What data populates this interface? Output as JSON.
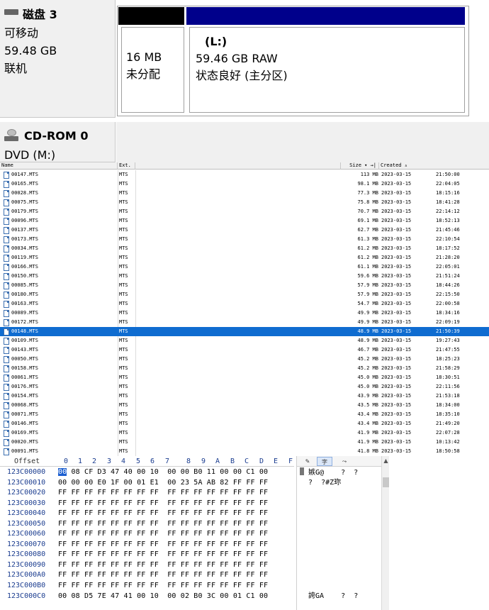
{
  "disk3": {
    "title": "磁盘 3",
    "type": "可移动",
    "size": "59.48 GB",
    "status": "联机",
    "partitions": [
      {
        "size": "16 MB",
        "state": "未分配"
      },
      {
        "volume": "(L:)",
        "size_fs": "59.46 GB RAW",
        "state": "状态良好 (主分区)"
      }
    ]
  },
  "cdrom": {
    "title": "CD-ROM 0",
    "drive": "DVD (M:)"
  },
  "file_list": {
    "columns": {
      "name": "Name",
      "ext": "Ext.",
      "size": "Size ▾ →|",
      "created": "Created ▵"
    },
    "selected_index": 17,
    "rows": [
      {
        "name": "00147.MTS",
        "ext": "MTS",
        "size": "113 MB",
        "date": "2023-03-15",
        "time": "21:50:00"
      },
      {
        "name": "00165.MTS",
        "ext": "MTS",
        "size": "98.1 MB",
        "date": "2023-03-15",
        "time": "22:04:05"
      },
      {
        "name": "00028.MTS",
        "ext": "MTS",
        "size": "77.3 MB",
        "date": "2023-03-15",
        "time": "18:15:16"
      },
      {
        "name": "00075.MTS",
        "ext": "MTS",
        "size": "75.8 MB",
        "date": "2023-03-15",
        "time": "18:41:28"
      },
      {
        "name": "00179.MTS",
        "ext": "MTS",
        "size": "70.7 MB",
        "date": "2023-03-15",
        "time": "22:14:12"
      },
      {
        "name": "00096.MTS",
        "ext": "MTS",
        "size": "69.1 MB",
        "date": "2023-03-15",
        "time": "18:52:13"
      },
      {
        "name": "00137.MTS",
        "ext": "MTS",
        "size": "62.7 MB",
        "date": "2023-03-15",
        "time": "21:45:46"
      },
      {
        "name": "00173.MTS",
        "ext": "MTS",
        "size": "61.3 MB",
        "date": "2023-03-15",
        "time": "22:10:54"
      },
      {
        "name": "00034.MTS",
        "ext": "MTS",
        "size": "61.2 MB",
        "date": "2023-03-15",
        "time": "18:17:52"
      },
      {
        "name": "00119.MTS",
        "ext": "MTS",
        "size": "61.2 MB",
        "date": "2023-03-15",
        "time": "21:28:20"
      },
      {
        "name": "00166.MTS",
        "ext": "MTS",
        "size": "61.1 MB",
        "date": "2023-03-15",
        "time": "22:05:01"
      },
      {
        "name": "00150.MTS",
        "ext": "MTS",
        "size": "59.6 MB",
        "date": "2023-03-15",
        "time": "21:51:24"
      },
      {
        "name": "00085.MTS",
        "ext": "MTS",
        "size": "57.9 MB",
        "date": "2023-03-15",
        "time": "18:44:26"
      },
      {
        "name": "00180.MTS",
        "ext": "MTS",
        "size": "57.9 MB",
        "date": "2023-03-15",
        "time": "22:15:50"
      },
      {
        "name": "00163.MTS",
        "ext": "MTS",
        "size": "54.7 MB",
        "date": "2023-03-15",
        "time": "22:00:58"
      },
      {
        "name": "00089.MTS",
        "ext": "MTS",
        "size": "49.9 MB",
        "date": "2023-03-15",
        "time": "18:34:16"
      },
      {
        "name": "00172.MTS",
        "ext": "MTS",
        "size": "49.9 MB",
        "date": "2023-03-15",
        "time": "22:09:19"
      },
      {
        "name": "00148.MTS",
        "ext": "MTS",
        "size": "48.9 MB",
        "date": "2023-03-15",
        "time": "21:50:39"
      },
      {
        "name": "00109.MTS",
        "ext": "MTS",
        "size": "48.9 MB",
        "date": "2023-03-15",
        "time": "19:27:43"
      },
      {
        "name": "00143.MTS",
        "ext": "MTS",
        "size": "46.7 MB",
        "date": "2023-03-15",
        "time": "21:47:55"
      },
      {
        "name": "00050.MTS",
        "ext": "MTS",
        "size": "45.2 MB",
        "date": "2023-03-15",
        "time": "18:25:23"
      },
      {
        "name": "00158.MTS",
        "ext": "MTS",
        "size": "45.2 MB",
        "date": "2023-03-15",
        "time": "21:58:29"
      },
      {
        "name": "00061.MTS",
        "ext": "MTS",
        "size": "45.0 MB",
        "date": "2023-03-15",
        "time": "18:30:51"
      },
      {
        "name": "00176.MTS",
        "ext": "MTS",
        "size": "45.0 MB",
        "date": "2023-03-15",
        "time": "22:11:56"
      },
      {
        "name": "00154.MTS",
        "ext": "MTS",
        "size": "43.9 MB",
        "date": "2023-03-15",
        "time": "21:53:18"
      },
      {
        "name": "00068.MTS",
        "ext": "MTS",
        "size": "43.5 MB",
        "date": "2023-03-15",
        "time": "18:34:00"
      },
      {
        "name": "00071.MTS",
        "ext": "MTS",
        "size": "43.4 MB",
        "date": "2023-03-15",
        "time": "18:35:10"
      },
      {
        "name": "00146.MTS",
        "ext": "MTS",
        "size": "43.4 MB",
        "date": "2023-03-15",
        "time": "21:49:20"
      },
      {
        "name": "00169.MTS",
        "ext": "MTS",
        "size": "41.9 MB",
        "date": "2023-03-15",
        "time": "22:07:28"
      },
      {
        "name": "00020.MTS",
        "ext": "MTS",
        "size": "41.9 MB",
        "date": "2023-03-15",
        "time": "10:13:42"
      },
      {
        "name": "00091.MTS",
        "ext": "MTS",
        "size": "41.8 MB",
        "date": "2023-03-15",
        "time": "18:50:58"
      }
    ]
  },
  "hex_view": {
    "offset_label": "Offset",
    "column_headers": [
      "0",
      "1",
      "2",
      "3",
      "4",
      "5",
      "6",
      "7",
      "8",
      "9",
      "A",
      "B",
      "C",
      "D",
      "E",
      "F"
    ],
    "rows": [
      {
        "offset": "123C00000",
        "first": "00",
        "rest": " 08 CF D3 47 40 00 10  00 00 B0 11 00 00 C1 00",
        "text": "嫉G@    ?  ?"
      },
      {
        "offset": "123C00010",
        "first": "",
        "rest": "00 00 00 E0 1F 00 01 E1  00 23 5A AB 82 FF FF FF",
        "text": "  ?  ?#Z珎"
      },
      {
        "offset": "123C00020",
        "first": "",
        "rest": "FF FF FF FF FF FF FF FF  FF FF FF FF FF FF FF FF",
        "text": ""
      },
      {
        "offset": "123C00030",
        "first": "",
        "rest": "FF FF FF FF FF FF FF FF  FF FF FF FF FF FF FF FF",
        "text": ""
      },
      {
        "offset": "123C00040",
        "first": "",
        "rest": "FF FF FF FF FF FF FF FF  FF FF FF FF FF FF FF FF",
        "text": ""
      },
      {
        "offset": "123C00050",
        "first": "",
        "rest": "FF FF FF FF FF FF FF FF  FF FF FF FF FF FF FF FF",
        "text": ""
      },
      {
        "offset": "123C00060",
        "first": "",
        "rest": "FF FF FF FF FF FF FF FF  FF FF FF FF FF FF FF FF",
        "text": ""
      },
      {
        "offset": "123C00070",
        "first": "",
        "rest": "FF FF FF FF FF FF FF FF  FF FF FF FF FF FF FF FF",
        "text": ""
      },
      {
        "offset": "123C00080",
        "first": "",
        "rest": "FF FF FF FF FF FF FF FF  FF FF FF FF FF FF FF FF",
        "text": ""
      },
      {
        "offset": "123C00090",
        "first": "",
        "rest": "FF FF FF FF FF FF FF FF  FF FF FF FF FF FF FF FF",
        "text": ""
      },
      {
        "offset": "123C000A0",
        "first": "",
        "rest": "FF FF FF FF FF FF FF FF  FF FF FF FF FF FF FF FF",
        "text": ""
      },
      {
        "offset": "123C000B0",
        "first": "",
        "rest": "FF FF FF FF FF FF FF FF  FF FF FF FF FF FF FF FF",
        "text": ""
      },
      {
        "offset": "123C000C0",
        "first": "",
        "rest": "00 08 D5 7E 47 41 00 10  00 02 B0 3C 00 01 C1 00",
        "text": "  誇GA    ?  ?"
      }
    ]
  },
  "colors": {
    "selection": "#0f6cd0",
    "partition_primary": "#00008b",
    "unallocated": "#000000",
    "offset_text": "#1a3c8f"
  }
}
